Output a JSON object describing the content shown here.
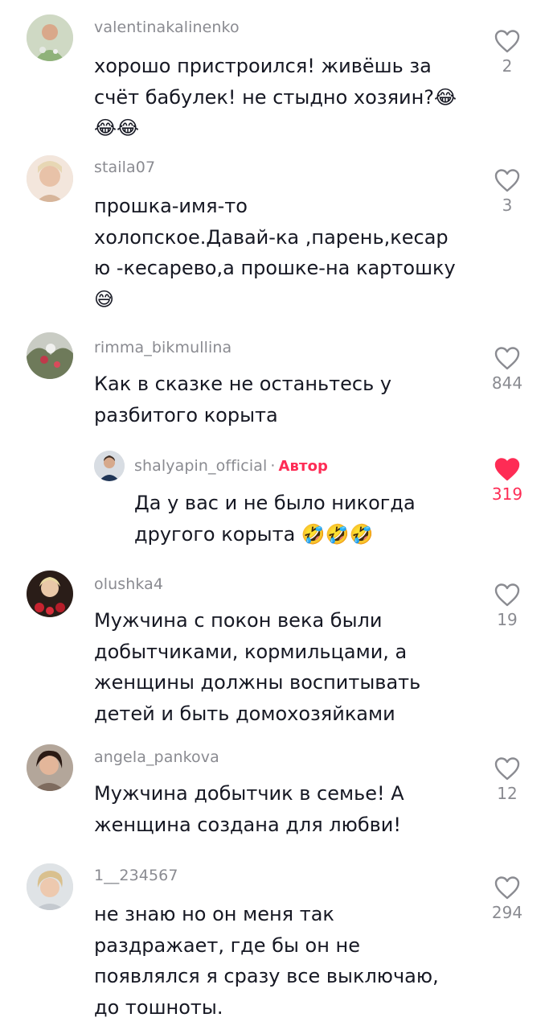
{
  "comments": [
    {
      "username": "valentinakalinenko",
      "lines": [
        "хорошо пристроился! живёшь за",
        "счёт бабулек! не стыдно хозяин?😂",
        "😂😂"
      ],
      "likes": "2"
    },
    {
      "username": "staila07",
      "lines": [
        "прошка-имя-то",
        "холопское.Давай-ка ,парень,кесар",
        "ю -кесарево,а прошке-на картошку",
        "😅"
      ],
      "likes": "3"
    },
    {
      "username": "rimma_bikmullina",
      "lines": [
        "Как в сказке не останьтесь у",
        "разбитого корыта"
      ],
      "likes": "844"
    },
    {
      "username": "shalyapin_official",
      "author_tag": "Автор",
      "separator": "·",
      "lines": [
        "Да у вас и не было никогда",
        "другого корыта 🤣🤣🤣"
      ],
      "likes": "319",
      "liked": true
    },
    {
      "username": "olushka4",
      "lines": [
        "Мужчина с покон века были",
        "добытчиками, кормильцами, а",
        "женщины должны воспитывать",
        "детей и быть домохозяйками"
      ],
      "likes": "19"
    },
    {
      "username": "angela_pankova",
      "lines": [
        "Мужчина добытчик в семье! А",
        "женщина создана для любви!"
      ],
      "likes": "12"
    },
    {
      "username": "1__234567",
      "lines": [
        "не знаю но он меня так",
        "раздражает, где бы он не",
        "появлялся я сразу все выключаю,",
        "до тошноты."
      ],
      "likes": "294"
    }
  ],
  "colors": {
    "accent": "#fe2c55",
    "muted": "#8a8b91",
    "text": "#161823"
  }
}
